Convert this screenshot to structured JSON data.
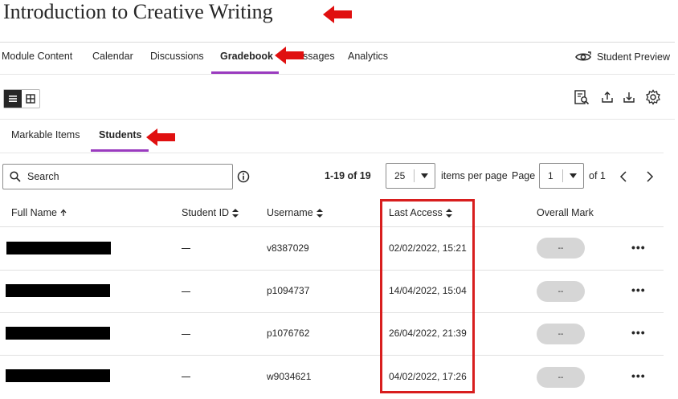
{
  "page": {
    "title": "Introduction to Creative Writing"
  },
  "nav": {
    "items": [
      "Module Content",
      "Calendar",
      "Discussions",
      "Gradebook",
      "ssages",
      "Analytics"
    ],
    "active": "Gradebook",
    "student_preview": "Student Preview"
  },
  "subtabs": {
    "markable": "Markable Items",
    "students": "Students",
    "active": "Students"
  },
  "search": {
    "placeholder": "Search"
  },
  "pager": {
    "range": "1-19 of 19",
    "per_page_value": "25",
    "items_per_page_label": "items per page",
    "page_label": "Page",
    "page_value": "1",
    "of_label": "of 1"
  },
  "table": {
    "columns": [
      "Full Name",
      "Student ID",
      "Username",
      "Last Access",
      "Overall Mark"
    ],
    "rows": [
      {
        "full_name": "",
        "student_id": "—",
        "username": "v8387029",
        "last_access": "02/02/2022, 15:21",
        "overall_mark": "--"
      },
      {
        "full_name": "",
        "student_id": "—",
        "username": "p1094737",
        "last_access": "14/04/2022, 15:04",
        "overall_mark": "--"
      },
      {
        "full_name": "",
        "student_id": "—",
        "username": "p1076762",
        "last_access": "26/04/2022, 21:39",
        "overall_mark": "--"
      },
      {
        "full_name": "",
        "student_id": "—",
        "username": "w9034621",
        "last_access": "04/02/2022, 17:26",
        "overall_mark": "--"
      }
    ],
    "more_label": "•••"
  },
  "icons": {
    "sort_asc": "arrow-up-icon",
    "sort_both": "sort-icon",
    "info": "info-icon",
    "preview": "eye-refresh-icon",
    "annotation_color": "#d81e1e",
    "accent": "#9a3bbf"
  }
}
